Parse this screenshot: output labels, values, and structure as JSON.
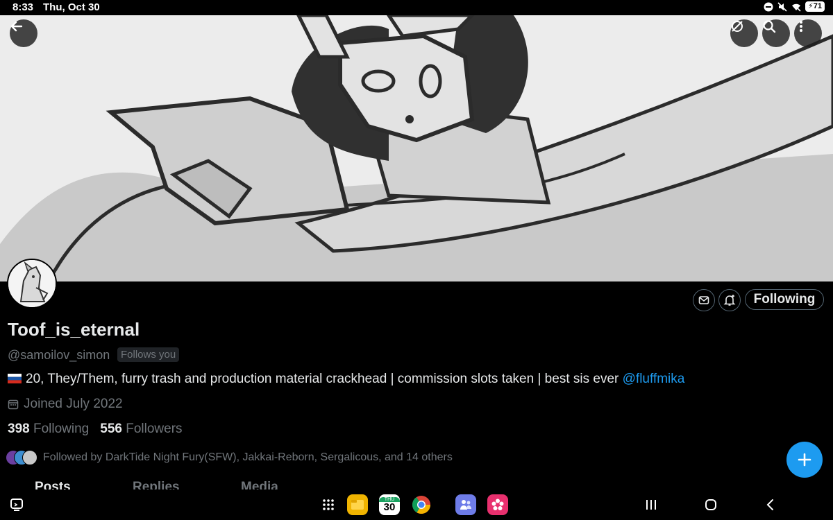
{
  "status_bar": {
    "time": "8:33",
    "date": "Thu, Oct 30",
    "battery": "71",
    "icons": [
      "dnd-icon",
      "mute-icon",
      "wifi-icon",
      "battery-icon"
    ]
  },
  "banner": {
    "back_icon": "arrow-left-icon",
    "actions": [
      "grok-icon",
      "search-icon",
      "more-vertical-icon"
    ]
  },
  "profile": {
    "display_name": "Toof_is_eternal",
    "handle": "@samoilov_simon",
    "follows_you": "Follows you",
    "bio_flag": "russia-flag-icon",
    "bio_text": "20, They/Them, furry trash and production material crackhead | commission slots taken | best sis ever ",
    "bio_mention": "@fluffmika",
    "joined": "Joined July 2022",
    "following_count": "398",
    "following_label": "Following",
    "followers_count": "556",
    "followers_label": "Followers",
    "followed_by": "Followed by DarkTide Night Fury(SFW), Jakkai-Reborn, Sergalicous, and 14 others",
    "follow_button": "Following"
  },
  "tabs": [
    {
      "label": "Posts",
      "active": true
    },
    {
      "label": "Replies",
      "active": false
    },
    {
      "label": "Media",
      "active": false
    }
  ],
  "nav": {
    "calendar_day_label": "THU",
    "calendar_day": "30",
    "dock": [
      "apps-grid-icon",
      "files-icon",
      "calendar-icon",
      "chrome-icon",
      "teams-icon",
      "gallery-icon"
    ],
    "keys": [
      "recents-icon",
      "home-icon",
      "back-icon"
    ]
  },
  "colors": {
    "accent": "#1d9bf0",
    "background": "#000000",
    "text_primary": "#e7e9ea",
    "text_secondary": "#71767b"
  }
}
